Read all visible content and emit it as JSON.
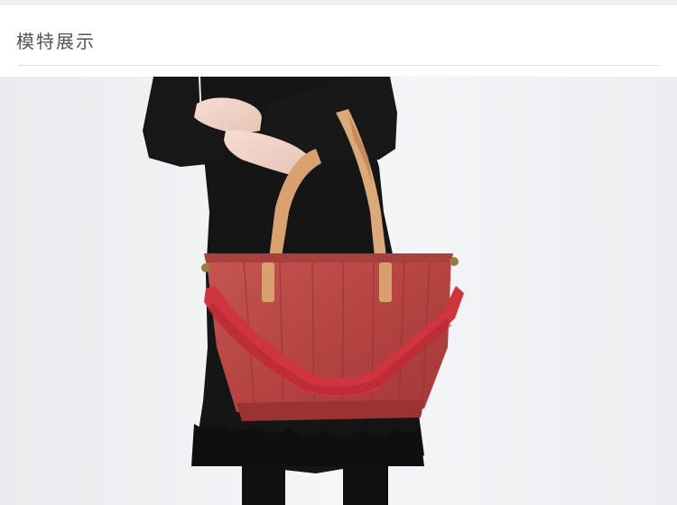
{
  "section": {
    "title": "模特展示"
  },
  "photo": {
    "subject": "model-holding-red-leather-tote",
    "colors": {
      "wall": "#f1f2f4",
      "dress": "#141414",
      "bag": "#b84444",
      "strap": "#d0343e",
      "handle": "#d9a070"
    }
  }
}
